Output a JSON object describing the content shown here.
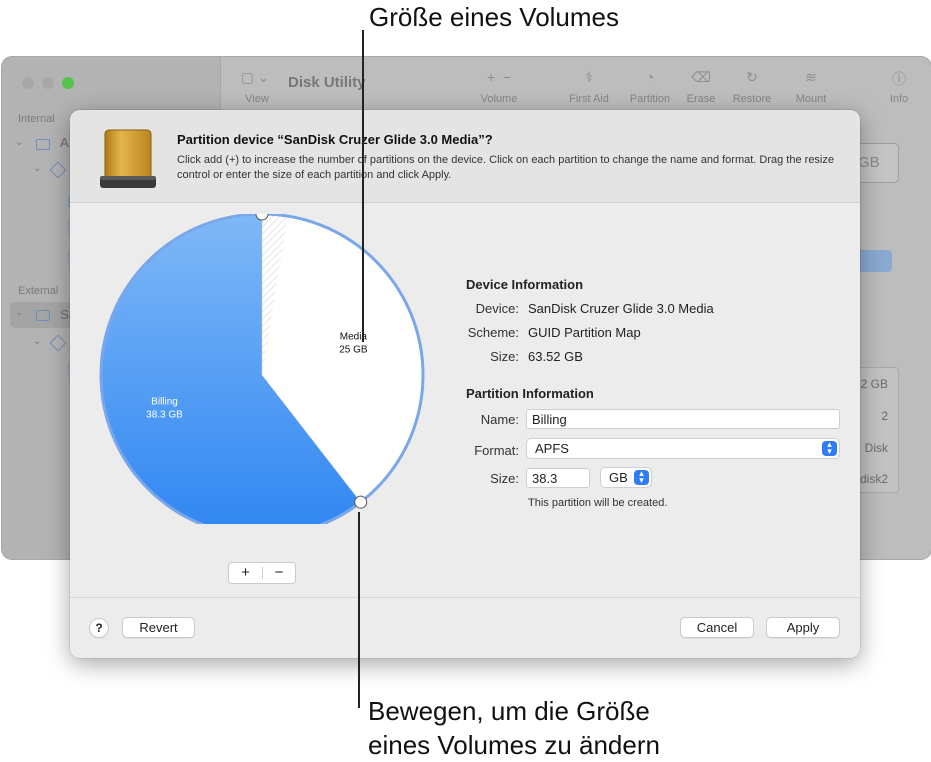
{
  "background_window": {
    "app_title": "Disk Utility",
    "sidebar": {
      "internal_header": "Internal",
      "external_header": "External",
      "internal_disk_label": "A",
      "external_disk_label": "Sa"
    },
    "toolbar": {
      "view": "View",
      "volume": "Volume",
      "first_aid": "First Aid",
      "partition": "Partition",
      "erase": "Erase",
      "restore": "Restore",
      "mount": "Mount",
      "info": "Info"
    },
    "right_panel": {
      "capacity_fragment": "GB",
      "rows": [
        "2 GB",
        "2",
        "Disk",
        "disk2"
      ]
    }
  },
  "dialog": {
    "title": "Partition device “SanDisk Cruzer Glide 3.0 Media”?",
    "description": "Click add (+) to increase the number of partitions on the device. Click on each partition to change the name and format. Drag the resize control or enter the size of each partition and click Apply.",
    "device_info": {
      "heading": "Device Information",
      "device_label": "Device:",
      "device_value": "SanDisk Cruzer Glide 3.0 Media",
      "scheme_label": "Scheme:",
      "scheme_value": "GUID Partition Map",
      "size_label": "Size:",
      "size_value": "63.52 GB"
    },
    "partition_info": {
      "heading": "Partition Information",
      "name_label": "Name:",
      "name_value": "Billing",
      "format_label": "Format:",
      "format_value": "APFS",
      "size_label": "Size:",
      "size_value": "38.3",
      "unit_value": "GB",
      "note": "This partition will be created."
    },
    "pie": {
      "partitions": [
        {
          "name": "Billing",
          "size": "38.3 GB",
          "value": 38.3,
          "color": "#3b8df5"
        },
        {
          "name": "Media",
          "size": "25 GB",
          "value": 25,
          "color": "#ffffff"
        }
      ],
      "total": 63.52,
      "add_symbol": "+",
      "remove_symbol": "−"
    },
    "buttons": {
      "help": "?",
      "revert": "Revert",
      "cancel": "Cancel",
      "apply": "Apply"
    }
  },
  "callouts": {
    "top": "Größe eines Volumes",
    "bottom_line1": "Bewegen, um die Größe",
    "bottom_line2": "eines Volumes zu ändern"
  }
}
